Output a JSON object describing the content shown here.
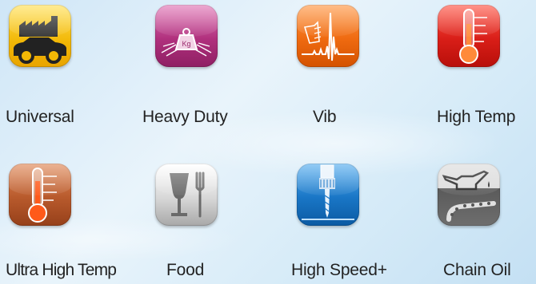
{
  "icons": [
    {
      "label": "Universal",
      "icon": "factory-car-icon",
      "color": "#f2b705"
    },
    {
      "label": "Heavy Duty",
      "icon": "weight-kg-icon",
      "color": "#b0307d",
      "weight_text": "Kg"
    },
    {
      "label": "Vib",
      "icon": "vibration-icon",
      "color": "#ef6a10"
    },
    {
      "label": "High Temp",
      "icon": "thermometer-icon",
      "color": "#d91e18"
    },
    {
      "label": "Ultra High Temp",
      "icon": "thermometer-icon",
      "color": "#b85a2c"
    },
    {
      "label": "Food",
      "icon": "glass-fork-icon",
      "color": "#b3b3b3"
    },
    {
      "label": "High Speed+",
      "icon": "drill-spindle-icon",
      "color": "#1976c6"
    },
    {
      "label": "Chain Oil",
      "icon": "oil-can-chain-icon",
      "color": "#6e6e6e"
    }
  ]
}
